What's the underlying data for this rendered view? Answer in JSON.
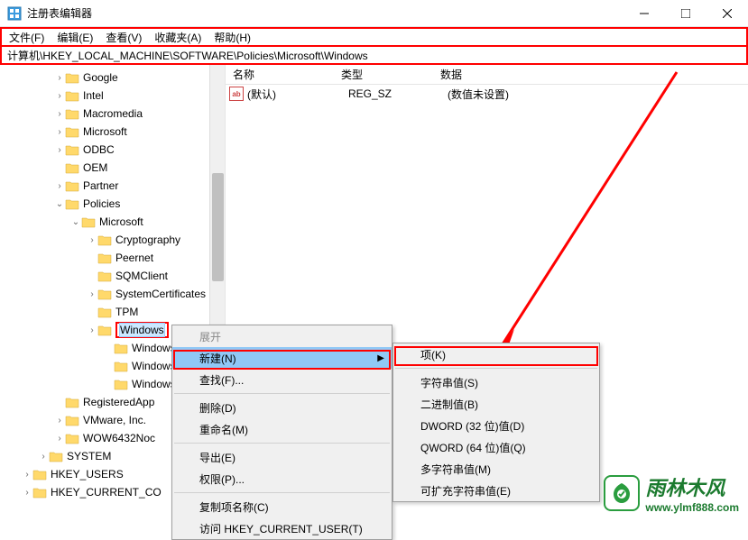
{
  "window": {
    "title": "注册表编辑器"
  },
  "menubar": {
    "file": "文件(F)",
    "edit": "编辑(E)",
    "view": "查看(V)",
    "favorites": "收藏夹(A)",
    "help": "帮助(H)"
  },
  "addressbar": {
    "path": "计算机\\HKEY_LOCAL_MACHINE\\SOFTWARE\\Policies\\Microsoft\\Windows"
  },
  "tree": {
    "items": [
      {
        "indent": 60,
        "caret": "closed",
        "label": "Google"
      },
      {
        "indent": 60,
        "caret": "closed",
        "label": "Intel"
      },
      {
        "indent": 60,
        "caret": "closed",
        "label": "Macromedia"
      },
      {
        "indent": 60,
        "caret": "closed",
        "label": "Microsoft"
      },
      {
        "indent": 60,
        "caret": "closed",
        "label": "ODBC"
      },
      {
        "indent": 60,
        "caret": "none",
        "label": "OEM"
      },
      {
        "indent": 60,
        "caret": "closed",
        "label": "Partner"
      },
      {
        "indent": 60,
        "caret": "open",
        "label": "Policies"
      },
      {
        "indent": 78,
        "caret": "open",
        "label": "Microsoft"
      },
      {
        "indent": 96,
        "caret": "closed",
        "label": "Cryptography"
      },
      {
        "indent": 96,
        "caret": "none",
        "label": "Peernet"
      },
      {
        "indent": 96,
        "caret": "none",
        "label": "SQMClient"
      },
      {
        "indent": 96,
        "caret": "closed",
        "label": "SystemCertificates"
      },
      {
        "indent": 96,
        "caret": "none",
        "label": "TPM"
      },
      {
        "indent": 96,
        "caret": "closed",
        "label": "Windows",
        "selected": true,
        "highlighted": true
      },
      {
        "indent": 114,
        "caret": "none",
        "label": "Windows"
      },
      {
        "indent": 114,
        "caret": "none",
        "label": "Windows"
      },
      {
        "indent": 114,
        "caret": "none",
        "label": "Windows"
      },
      {
        "indent": 60,
        "caret": "none",
        "label": "RegisteredApp"
      },
      {
        "indent": 60,
        "caret": "closed",
        "label": "VMware, Inc."
      },
      {
        "indent": 60,
        "caret": "closed",
        "label": "WOW6432Noc"
      },
      {
        "indent": 42,
        "caret": "closed",
        "label": "SYSTEM"
      },
      {
        "indent": 24,
        "caret": "closed",
        "label": "HKEY_USERS"
      },
      {
        "indent": 24,
        "caret": "closed",
        "label": "HKEY_CURRENT_CO"
      }
    ]
  },
  "columns": {
    "name": "名称",
    "type": "类型",
    "data": "数据"
  },
  "values": [
    {
      "name": "(默认)",
      "type": "REG_SZ",
      "data": "(数值未设置)"
    }
  ],
  "context_menu": {
    "expand": "展开",
    "new": "新建(N)",
    "find": "查找(F)...",
    "delete": "删除(D)",
    "rename": "重命名(M)",
    "export": "导出(E)",
    "permissions": "权限(P)...",
    "copy_key": "复制项名称(C)",
    "goto": "访问 HKEY_CURRENT_USER(T)"
  },
  "submenu": {
    "key": "项(K)",
    "string": "字符串值(S)",
    "binary": "二进制值(B)",
    "dword": "DWORD (32 位)值(D)",
    "qword": "QWORD (64 位)值(Q)",
    "multi": "多字符串值(M)",
    "expand": "可扩充字符串值(E)"
  },
  "watermark": {
    "title": "雨林木风",
    "url": "www.ylmf888.com"
  }
}
